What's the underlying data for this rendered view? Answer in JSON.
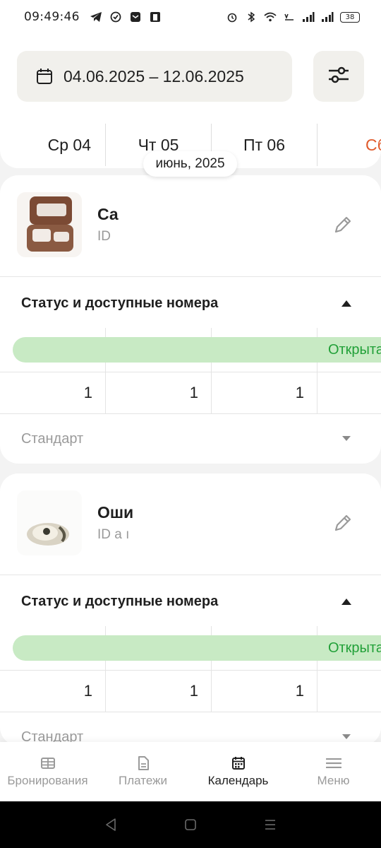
{
  "statusbar": {
    "time": "09:49:46",
    "battery": "38"
  },
  "header": {
    "date_range": "04.06.2025 – 12.06.2025"
  },
  "days": [
    "Ср 04",
    "Чт 05",
    "Пт 06",
    "Сб"
  ],
  "month_label": "июнь, 2025",
  "cards": [
    {
      "name": "Са",
      "id_label": "ID",
      "section_title": "Статус и доступные номера",
      "status": "Открыта",
      "counts": [
        "1",
        "1",
        "1"
      ],
      "room_type": "Стандарт"
    },
    {
      "name": "Оши",
      "id_label": "ID а ı",
      "section_title": "Статус и доступные номера",
      "status": "Открыта",
      "counts": [
        "1",
        "1",
        "1"
      ],
      "room_type": "Стандарт"
    }
  ],
  "bottom_nav": {
    "items": [
      {
        "label": "Бронирования",
        "icon": "table-icon"
      },
      {
        "label": "Платежи",
        "icon": "document-icon"
      },
      {
        "label": "Календарь",
        "icon": "calendar-icon"
      },
      {
        "label": "Меню",
        "icon": "menu-icon"
      }
    ],
    "active": "Календарь"
  },
  "colors": {
    "status_open_bg": "#c8eac4",
    "status_open_text": "#21a038",
    "weekend": "#e05a2b"
  }
}
